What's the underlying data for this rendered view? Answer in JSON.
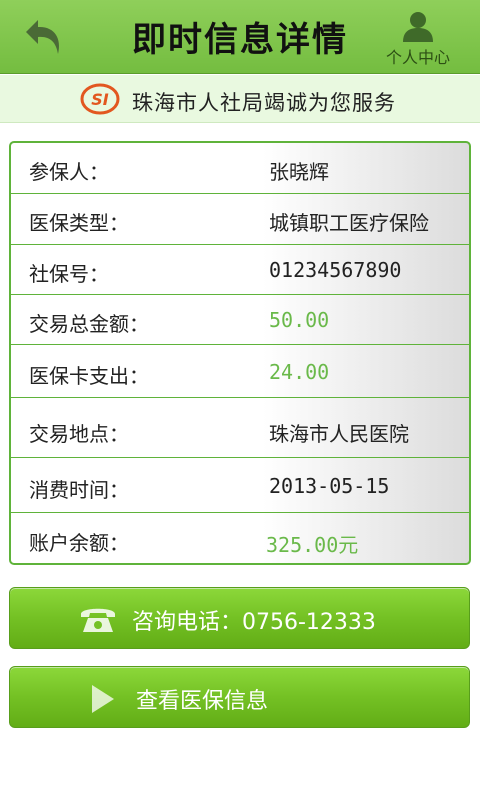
{
  "header": {
    "title": "即时信息详情",
    "user_center_label": "个人中心"
  },
  "banner": {
    "logo_text": "SI",
    "slogan": "珠海市人社局竭诚为您服务"
  },
  "info": {
    "rows": [
      {
        "label": "参保人：",
        "value": "张晓辉"
      },
      {
        "label": "医保类型：",
        "value": "城镇职工医疗保险"
      },
      {
        "label": "社保号：",
        "value": "01234567890"
      },
      {
        "label": "交易总金额：",
        "value": "50.00"
      },
      {
        "label": "医保卡支出：",
        "value": "24.00"
      },
      {
        "label": "交易地点：",
        "value": "珠海市人民医院"
      },
      {
        "label": "消费时间：",
        "value": "2013-05-15"
      },
      {
        "label": "账户余额：",
        "value": "325.00元"
      }
    ]
  },
  "buttons": {
    "phone_label": "咨询电话：0756-12333",
    "view_info_label": "查看医保信息"
  },
  "colors": {
    "header_green": "#74bd40",
    "accent_green": "#6ab94a",
    "button_green": "#74c124"
  }
}
